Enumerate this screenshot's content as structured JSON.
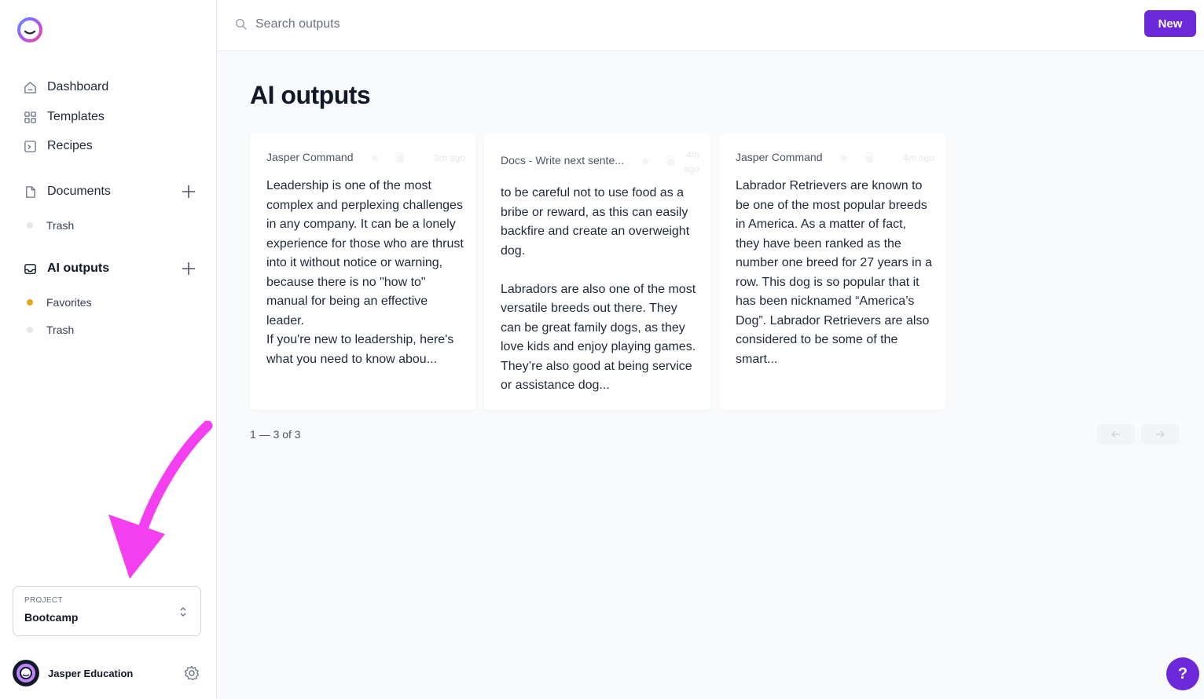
{
  "sidebar": {
    "nav": [
      {
        "label": "Dashboard",
        "icon": "home-icon"
      },
      {
        "label": "Templates",
        "icon": "grid-icon"
      },
      {
        "label": "Recipes",
        "icon": "terminal-icon"
      }
    ],
    "documents": {
      "label": "Documents",
      "trash": "Trash"
    },
    "ai_outputs": {
      "label": "AI outputs",
      "favorites": "Favorites",
      "trash": "Trash"
    },
    "project": {
      "label": "PROJECT",
      "name": "Bootcamp"
    },
    "user": {
      "name": "Jasper Education"
    }
  },
  "topbar": {
    "search_placeholder": "Search outputs",
    "new_label": "New"
  },
  "main": {
    "title": "AI outputs",
    "cards": [
      {
        "source": "Jasper Command",
        "time": "3m ago",
        "text": "Leadership is one of the most complex and perplexing challenges in any company. It can be a lonely experience for those who are thrust into it without notice or warning, because there is no \"how to\" manual for being an effective leader.\nIf you're new to leadership, here's what you need to know abou..."
      },
      {
        "source": "Docs - Write next sente...",
        "time": "4m ago",
        "text": "to be careful not to use food as a bribe or reward, as this can easily backfire and create an overweight dog.\n\nLabradors are also one of the most versatile breeds out there. They can be great family dogs, as they love kids and enjoy playing games. They’re also good at being service or assistance dog..."
      },
      {
        "source": "Jasper Command",
        "time": "4m ago",
        "text": "Labrador Retrievers are known to be one of the most popular breeds in America. As a matter of fact, they have been ranked as the number one breed for 27 years in a row.  This dog is so popular that it has been nicknamed “America’s Dog”. Labrador Retrievers are also considered to be some of the smart..."
      }
    ],
    "pager": "1 — 3 of 3"
  },
  "help_label": "?",
  "colors": {
    "accent": "#6d28d9",
    "favorite_dot": "#e0a91b",
    "annotation_arrow": "#f43ff0"
  }
}
